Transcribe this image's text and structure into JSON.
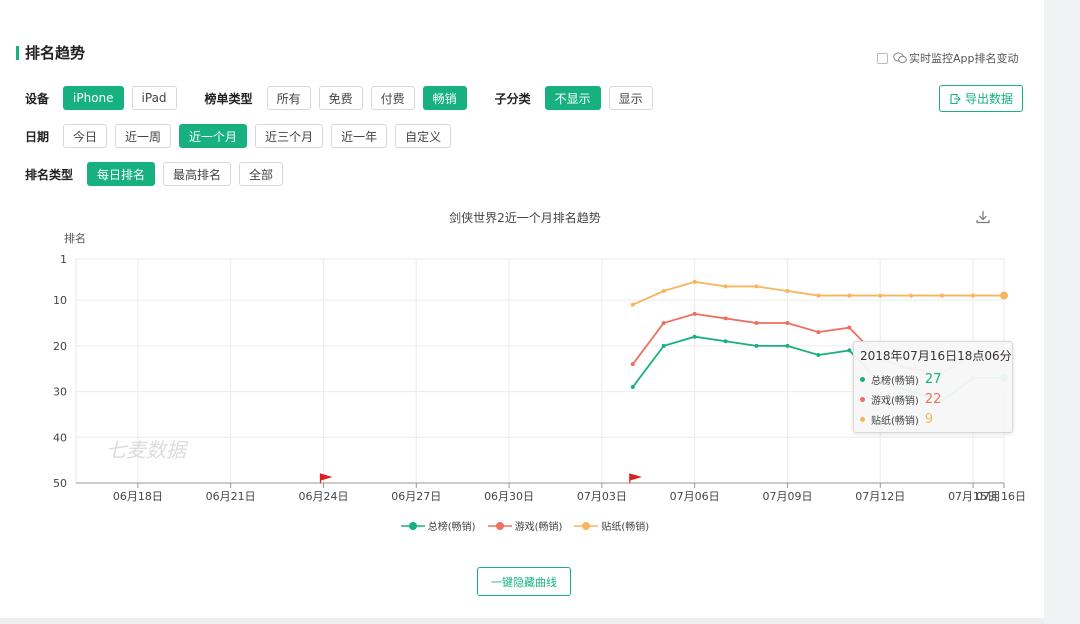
{
  "section": {
    "title": "排名趋势"
  },
  "monitor": {
    "label": "实时监控App排名变动"
  },
  "export": {
    "label": "导出数据"
  },
  "device": {
    "label": "设备",
    "options": [
      {
        "label": "iPhone",
        "active": true
      },
      {
        "label": "iPad",
        "active": false
      }
    ]
  },
  "list_type": {
    "label": "榜单类型",
    "options": [
      {
        "label": "所有",
        "active": false
      },
      {
        "label": "免费",
        "active": false
      },
      {
        "label": "付费",
        "active": false
      },
      {
        "label": "畅销",
        "active": true
      }
    ]
  },
  "sub_category": {
    "label": "子分类",
    "options": [
      {
        "label": "不显示",
        "active": true
      },
      {
        "label": "显示",
        "active": false
      }
    ]
  },
  "date": {
    "label": "日期",
    "options": [
      {
        "label": "今日",
        "active": false
      },
      {
        "label": "近一周",
        "active": false
      },
      {
        "label": "近一个月",
        "active": true
      },
      {
        "label": "近三个月",
        "active": false
      },
      {
        "label": "近一年",
        "active": false
      },
      {
        "label": "自定义",
        "active": false
      }
    ]
  },
  "rank_type": {
    "label": "排名类型",
    "options": [
      {
        "label": "每日排名",
        "active": true
      },
      {
        "label": "最高排名",
        "active": false
      },
      {
        "label": "全部",
        "active": false
      }
    ]
  },
  "watermark": "七麦数据",
  "tooltip": {
    "date": "2018年07月16日18点06分",
    "rows": [
      {
        "label": "总榜(畅销)",
        "value": "27",
        "color": "#16b17f"
      },
      {
        "label": "游戏(畅销)",
        "value": "22",
        "color": "#ee6f61"
      },
      {
        "label": "贴纸(畅销)",
        "value": "9",
        "color": "#f7b55c"
      }
    ]
  },
  "hide_button": {
    "label": "一键隐藏曲线"
  },
  "colors": {
    "accent": "#16b17f",
    "total": "#16b17f",
    "game": "#ee6f61",
    "sticker": "#f7b55c"
  },
  "chart_data": {
    "type": "line",
    "title": "剑侠世界2近一个月排名趋势",
    "ylabel": "排名",
    "xlabel": "",
    "y_inverted": true,
    "ylim": [
      1,
      50
    ],
    "yticks": [
      1,
      10,
      20,
      30,
      40,
      50
    ],
    "x_range": [
      "2018-06-16",
      "2018-07-16"
    ],
    "xticks": [
      {
        "date": "2018-06-18",
        "label": "06月18日"
      },
      {
        "date": "2018-06-21",
        "label": "06月21日"
      },
      {
        "date": "2018-06-24",
        "label": "06月24日"
      },
      {
        "date": "2018-06-27",
        "label": "06月27日"
      },
      {
        "date": "2018-06-30",
        "label": "06月30日"
      },
      {
        "date": "2018-07-03",
        "label": "07月03日"
      },
      {
        "date": "2018-07-06",
        "label": "07月06日"
      },
      {
        "date": "2018-07-09",
        "label": "07月09日"
      },
      {
        "date": "2018-07-12",
        "label": "07月12日"
      },
      {
        "date": "2018-07-15",
        "label": "07月15日"
      },
      {
        "date": "2018-07-16",
        "label": "07月16日"
      }
    ],
    "markers": [
      "2018-06-24",
      "2018-07-04"
    ],
    "x": [
      "2018-07-04",
      "2018-07-05",
      "2018-07-06",
      "2018-07-07",
      "2018-07-08",
      "2018-07-09",
      "2018-07-10",
      "2018-07-11",
      "2018-07-12",
      "2018-07-13",
      "2018-07-14",
      "2018-07-15",
      "2018-07-16"
    ],
    "series": [
      {
        "name": "总榜(畅销)",
        "color": "#16b17f",
        "values": [
          29,
          20,
          18,
          19,
          20,
          20,
          22,
          21,
          28,
          30,
          32,
          27,
          27
        ]
      },
      {
        "name": "游戏(畅销)",
        "color": "#ee6f61",
        "values": [
          24,
          15,
          13,
          14,
          15,
          15,
          17,
          16,
          23,
          25,
          26,
          22,
          22
        ]
      },
      {
        "name": "贴纸(畅销)",
        "color": "#f7b55c",
        "values": [
          11,
          8,
          6,
          7,
          7,
          8,
          9,
          9,
          9,
          9,
          9,
          9,
          9
        ]
      }
    ],
    "grid": true,
    "legend": "bottom-center"
  }
}
